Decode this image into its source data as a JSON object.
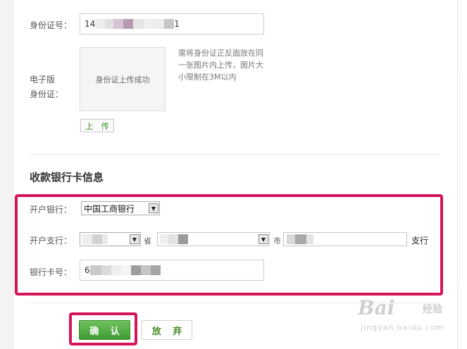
{
  "identity": {
    "id_label": "身份证号：",
    "id_value_start": "14",
    "id_value_end": "1",
    "id_photo_label_line1": "电子版",
    "id_photo_label_line2": "身份证：",
    "upload_status": "身份证上传成功",
    "upload_note": "需将身份证正反面放在同一张图片内上传，图片大小限制在3M以内",
    "upload_button": "上 传"
  },
  "bank": {
    "section_title": "收款银行卡信息",
    "bank_label": "开户银行：",
    "bank_selected": "中国工商银行",
    "branch_label": "开户支行：",
    "province_unit": "省",
    "city_unit": "市",
    "branch_suffix": "支行",
    "card_label": "银行卡号：",
    "card_value_start": "6"
  },
  "actions": {
    "confirm": "确 认",
    "cancel": "放 弃"
  },
  "watermark": {
    "logo": "Bai",
    "cn": "经验",
    "url": "jingyan.baidu.com"
  },
  "colors": {
    "highlight": "#d4145a",
    "confirm_green": "#4aa83c",
    "accent_green": "#3a8d2a"
  },
  "icons": [
    "dropdown-arrow-icon"
  ]
}
